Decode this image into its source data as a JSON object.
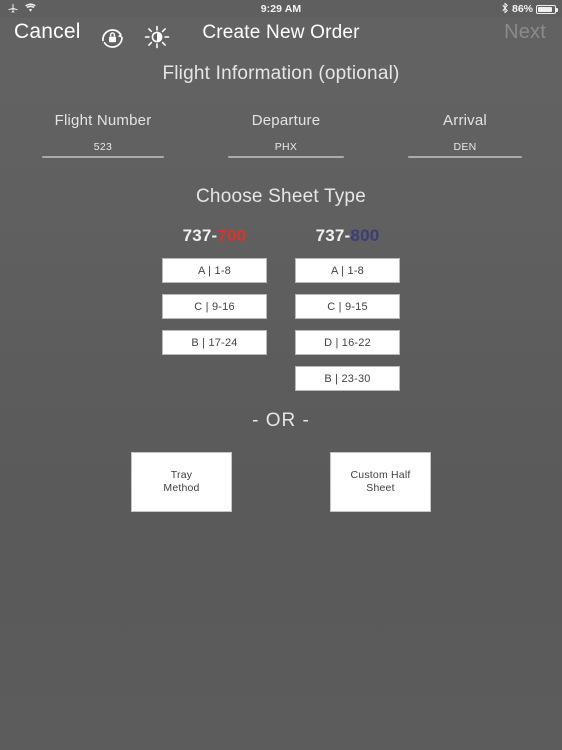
{
  "status_bar": {
    "airplane_icon": "airplane-icon",
    "wifi_icon": "wifi-icon",
    "time": "9:29 AM",
    "bluetooth_icon": "bluetooth-icon",
    "battery_percent": "86%",
    "battery_icon": "battery-icon"
  },
  "nav_bar": {
    "cancel_label": "Cancel",
    "rotation_lock_icon": "rotation-lock-icon",
    "brightness_icon": "brightness-icon",
    "title": "Create New Order",
    "next_label": "Next",
    "next_enabled": false
  },
  "flight_info": {
    "section_title": "Flight Information (optional)",
    "fields": [
      {
        "label": "Flight Number",
        "value": "523"
      },
      {
        "label": "Departure",
        "value": "PHX"
      },
      {
        "label": "Arrival",
        "value": "DEN"
      }
    ]
  },
  "sheet_type": {
    "section_title": "Choose Sheet Type",
    "columns": [
      {
        "model_prefix": "737-",
        "model_suffix": "700",
        "accent_color": "#e23127",
        "buttons": [
          {
            "label": "A | 1-8"
          },
          {
            "label": "C | 9-16"
          },
          {
            "label": "B | 17-24"
          }
        ]
      },
      {
        "model_prefix": "737-",
        "model_suffix": "800",
        "accent_color": "#3c3c78",
        "buttons": [
          {
            "label": "A | 1-8"
          },
          {
            "label": "C | 9-15"
          },
          {
            "label": "D | 16-22"
          },
          {
            "label": "B | 23-30"
          }
        ]
      }
    ]
  },
  "alternate": {
    "or_label": "- OR -",
    "tray_method_label": "Tray\nMethod",
    "custom_half_sheet_label": "Custom Half\nSheet"
  }
}
